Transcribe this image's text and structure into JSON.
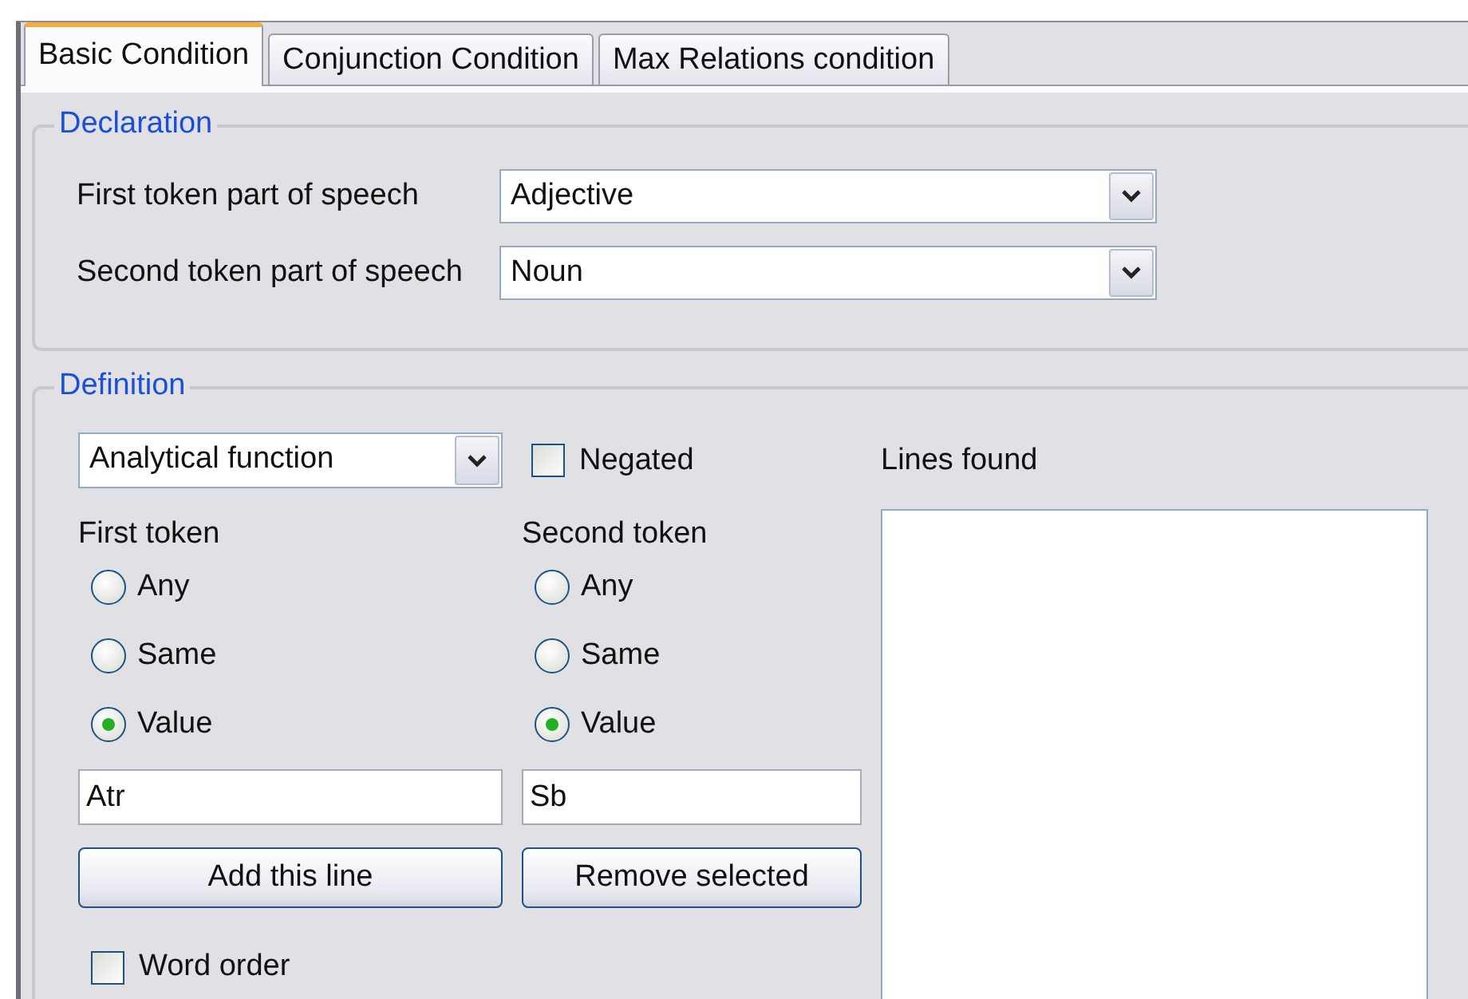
{
  "tabs": [
    {
      "label": "Basic Condition",
      "selected": true
    },
    {
      "label": "Conjunction Condition",
      "selected": false
    },
    {
      "label": "Max Relations condition",
      "selected": false
    }
  ],
  "declaration": {
    "legend": "Declaration",
    "fields": [
      {
        "label": "First token part of speech",
        "value": "Adjective"
      },
      {
        "label": "Second token part of speech",
        "value": "Noun"
      }
    ]
  },
  "definition": {
    "legend": "Definition",
    "function_select": {
      "value": "Analytical function"
    },
    "negated": {
      "label": "Negated",
      "checked": false
    },
    "lines_found": {
      "label": "Lines found"
    },
    "tokens": [
      {
        "heading": "First token",
        "options": [
          {
            "label": "Any",
            "selected": false
          },
          {
            "label": "Same",
            "selected": false
          },
          {
            "label": "Value",
            "selected": true
          }
        ],
        "value": "Atr"
      },
      {
        "heading": "Second token",
        "options": [
          {
            "label": "Any",
            "selected": false
          },
          {
            "label": "Same",
            "selected": false
          },
          {
            "label": "Value",
            "selected": true
          }
        ],
        "value": "Sb"
      }
    ],
    "buttons": [
      "Add this line",
      "Remove selected"
    ],
    "word_order": {
      "label": "Word order",
      "checked": false
    }
  }
}
